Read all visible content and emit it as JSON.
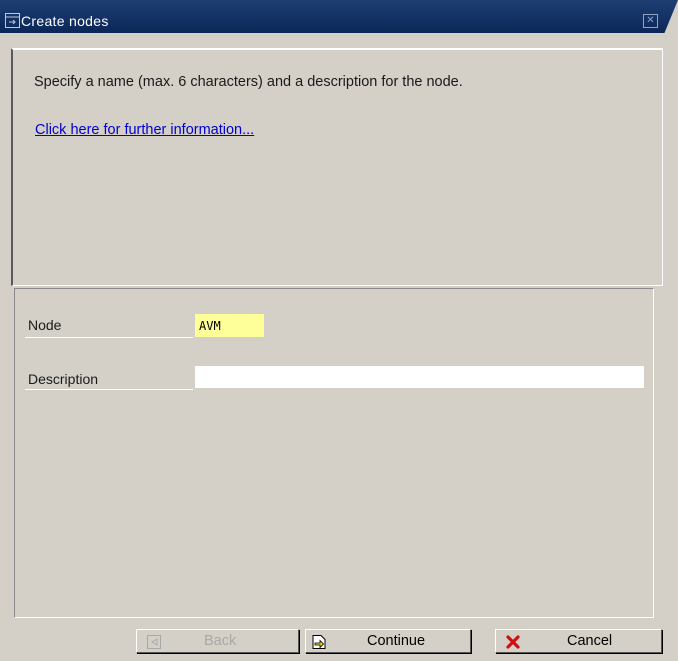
{
  "window": {
    "title": "Create nodes"
  },
  "info": {
    "text": "Specify a name (max. 6 characters) and a description for the node.",
    "link": "Click here for further information..."
  },
  "form": {
    "node_label": "Node",
    "node_value": "AVM",
    "description_label": "Description",
    "description_value": ""
  },
  "buttons": {
    "back": "Back",
    "continue": "Continue",
    "cancel": "Cancel"
  },
  "icons": {
    "title": "window-icon",
    "close": "close-icon",
    "back": "back-icon",
    "continue": "continue-icon",
    "cancel": "cancel-x-icon"
  },
  "colors": {
    "titlebar": "#0b2758",
    "panel": "#d4d0c8",
    "required_field": "#ffff99",
    "link": "#0000d0"
  }
}
